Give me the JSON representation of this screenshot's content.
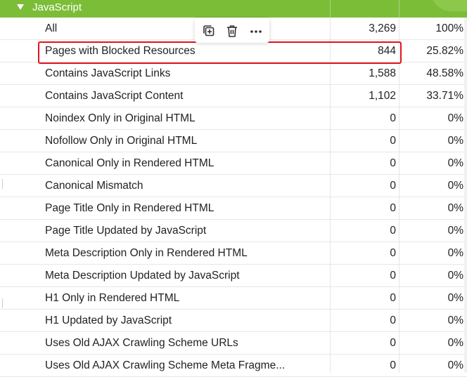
{
  "section": {
    "title": "JavaScript",
    "color": "#7cbd38"
  },
  "toolbar": {
    "duplicate_icon": "copy-plus-icon",
    "delete_icon": "trash-icon",
    "more_icon": "more-horizontal-icon"
  },
  "rows": [
    {
      "label": "All",
      "count": "3,269",
      "percent": "100%"
    },
    {
      "label": "Pages with Blocked Resources",
      "count": "844",
      "percent": "25.82%",
      "selected": true
    },
    {
      "label": "Contains JavaScript Links",
      "count": "1,588",
      "percent": "48.58%"
    },
    {
      "label": "Contains JavaScript Content",
      "count": "1,102",
      "percent": "33.71%"
    },
    {
      "label": "Noindex Only in Original HTML",
      "count": "0",
      "percent": "0%"
    },
    {
      "label": "Nofollow Only in Original HTML",
      "count": "0",
      "percent": "0%"
    },
    {
      "label": "Canonical Only in Rendered HTML",
      "count": "0",
      "percent": "0%"
    },
    {
      "label": "Canonical Mismatch",
      "count": "0",
      "percent": "0%"
    },
    {
      "label": "Page Title Only in Rendered HTML",
      "count": "0",
      "percent": "0%"
    },
    {
      "label": "Page Title Updated by JavaScript",
      "count": "0",
      "percent": "0%"
    },
    {
      "label": "Meta Description Only in Rendered HTML",
      "count": "0",
      "percent": "0%"
    },
    {
      "label": "Meta Description Updated by JavaScript",
      "count": "0",
      "percent": "0%"
    },
    {
      "label": "H1 Only in Rendered HTML",
      "count": "0",
      "percent": "0%"
    },
    {
      "label": "H1 Updated by JavaScript",
      "count": "0",
      "percent": "0%"
    },
    {
      "label": "Uses Old AJAX Crawling Scheme URLs",
      "count": "0",
      "percent": "0%"
    },
    {
      "label": "Uses Old AJAX Crawling Scheme Meta Fragme...",
      "count": "0",
      "percent": "0%"
    }
  ],
  "selection_color": "#e0141e"
}
